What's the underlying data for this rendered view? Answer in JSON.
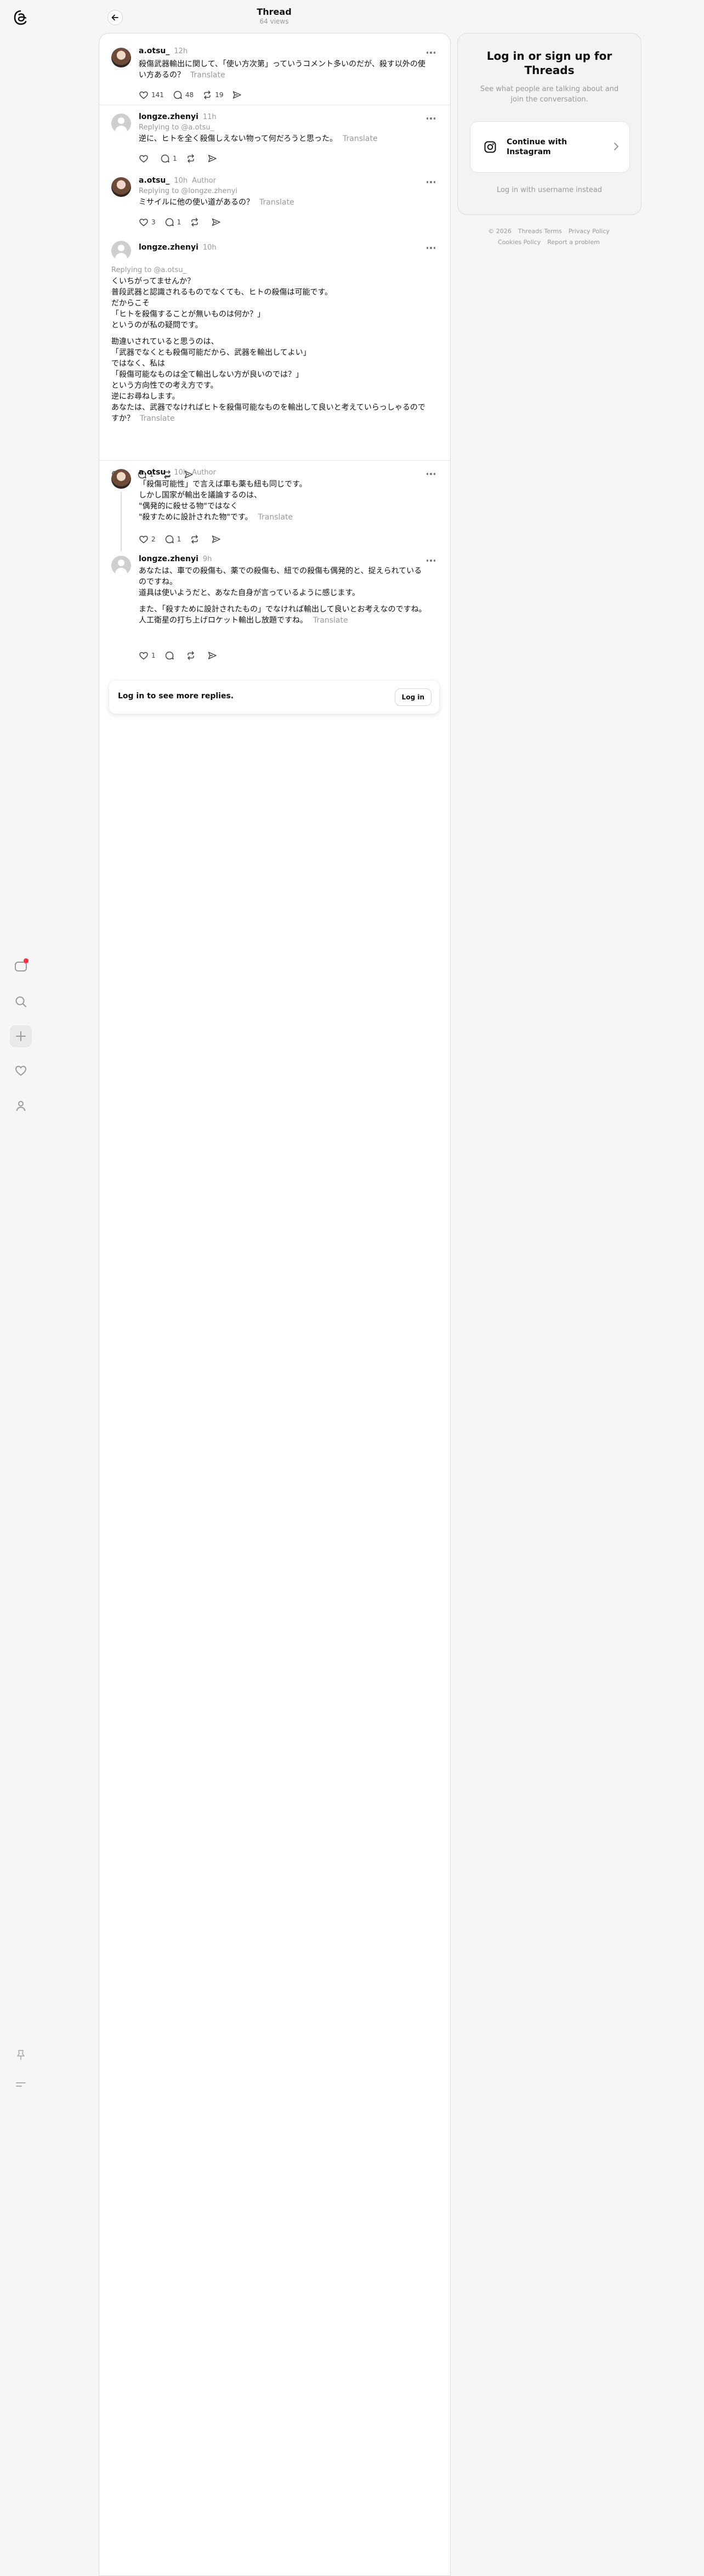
{
  "header": {
    "title": "Thread",
    "views": "64 views"
  },
  "posts": [
    {
      "username": "a.otsu_",
      "time": "12h",
      "author_tag": "",
      "reply_to": "",
      "lines": [
        "殺傷武器輸出に関して、「使い方次第」っていうコメント多いのだが、殺す以外の使い方あるの？"
      ],
      "translate": "Translate",
      "likes": "141",
      "replies": "48",
      "reposts": "19",
      "shares": ""
    },
    {
      "username": "longze.zhenyi",
      "time": "11h",
      "author_tag": "",
      "reply_to": "Replying to @a.otsu_",
      "lines": [
        "逆に、ヒトを全く殺傷しえない物って何だろうと思った。"
      ],
      "translate": "Translate",
      "likes": "",
      "replies": "1",
      "reposts": "",
      "shares": ""
    },
    {
      "username": "a.otsu_",
      "time": "10h",
      "author_tag": "Author",
      "reply_to": "Replying to @longze.zhenyi",
      "lines": [
        "ミサイルに他の使い道があるの？"
      ],
      "translate": "Translate",
      "likes": "3",
      "replies": "1",
      "reposts": "",
      "shares": ""
    },
    {
      "username": "longze.zhenyi",
      "time": "10h",
      "author_tag": "",
      "reply_to": "Replying to @a.otsu_",
      "paragraphs": [
        [
          "くいちがってませんか？",
          "普段武器と認識されるものでなくても、ヒトの殺傷は可能です。",
          "だからこそ",
          "「ヒトを殺傷することが無いものは何か？」",
          "というのが私の疑問です。"
        ],
        [
          "勘違いされていると思うのは、",
          "「武器でなくとも殺傷可能だから、武器を輸出してよい」",
          "ではなく、私は",
          "「殺傷可能なものは全て輸出しない方が良いのでは？」",
          "という方向性での考え方です。",
          "逆にお尋ねします。",
          "あなたは、武器でなければヒトを殺傷可能なものを輸出して良いと考えていらっしゃるのですか？"
        ]
      ],
      "translate": "Translate",
      "likes": "1",
      "replies": "1",
      "reposts": "",
      "shares": ""
    },
    {
      "username": "a.otsu_",
      "time": "10h",
      "author_tag": "Author",
      "reply_to": "",
      "lines": [
        "「殺傷可能性」で言えば車も薬も紐も同じです。",
        "しかし国家が輸出を議論するのは、",
        "\"偶発的に殺せる物\"ではなく",
        "\"殺すために設計された物\"です。"
      ],
      "translate": "Translate",
      "likes": "2",
      "replies": "1",
      "reposts": "",
      "shares": ""
    },
    {
      "username": "longze.zhenyi",
      "time": "9h",
      "author_tag": "",
      "reply_to": "",
      "paragraphs": [
        [
          "あなたは、車での殺傷も、薬での殺傷も、紐での殺傷も偶発的と、捉えられているのですね。",
          "道具は使いようだと、あなた自身が言っているように感じます。"
        ],
        [
          "また、「殺すために設計されたもの」でなければ輸出して良いとお考えなのですね。",
          "人工衛星の打ち上げロケット輸出し放題ですね。"
        ]
      ],
      "translate": "Translate",
      "likes": "1",
      "replies": "",
      "reposts": "",
      "shares": ""
    }
  ],
  "more_replies": {
    "text": "Log in to see more replies.",
    "button": "Log in"
  },
  "login_panel": {
    "title": "Log in or sign up for Threads",
    "subtitle": "See what people are talking about and join the conversation.",
    "instagram_button": "Continue with Instagram",
    "username_login": "Log in with username instead"
  },
  "footer": {
    "copyright": "© 2026",
    "terms": "Threads Terms",
    "privacy": "Privacy Policy",
    "cookies": "Cookies Policy",
    "report": "Report a problem"
  },
  "colors": {
    "notification_dot": "#ff3040",
    "muted_text": "#999999",
    "background": "#f6f6f6"
  },
  "icons": [
    "threads-logo-icon",
    "back-arrow-icon",
    "activity-icon",
    "search-icon",
    "create-icon",
    "heart-icon",
    "profile-icon",
    "pin-icon",
    "menu-icon",
    "like-icon",
    "comment-icon",
    "repost-icon",
    "share-icon",
    "more-icon",
    "instagram-icon",
    "chevron-right-icon"
  ]
}
